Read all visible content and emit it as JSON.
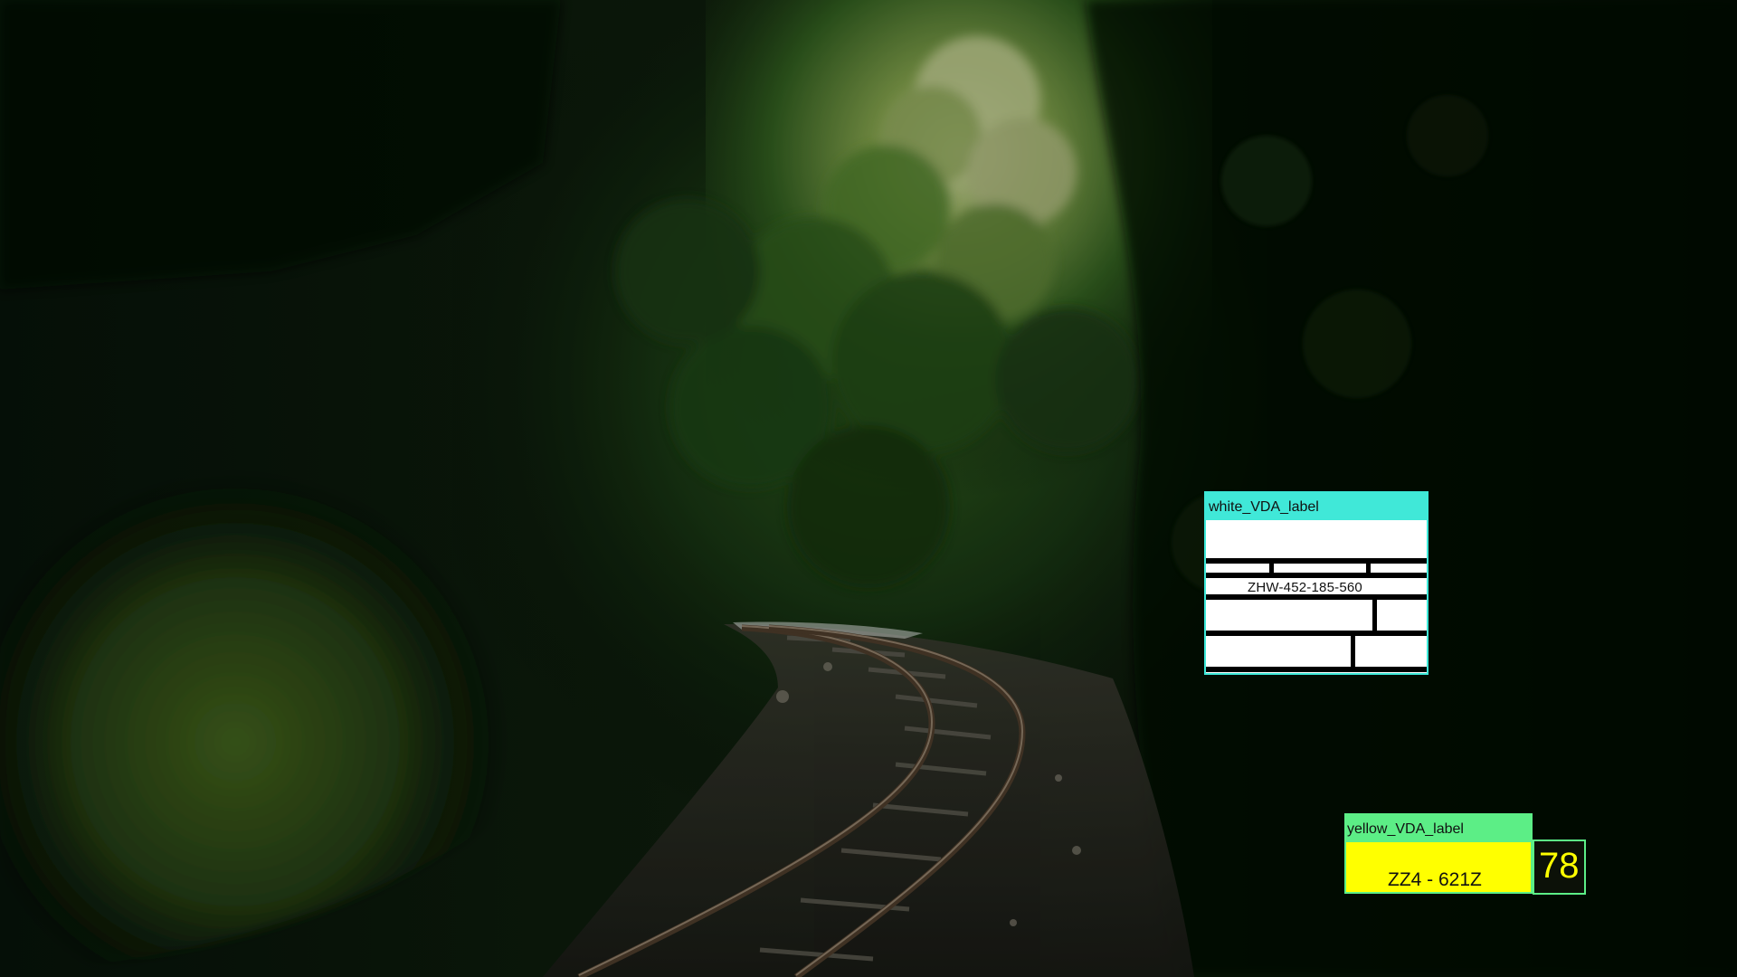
{
  "annotations": {
    "white_label": {
      "title": "white_VDA_label",
      "code": "ZHW-452-185-560",
      "border_color": "#3de8d8"
    },
    "yellow_label": {
      "title": "yellow_VDA_label",
      "code": "ZZ4 - 621Z",
      "score": "78",
      "border_color": "#5cee86",
      "fill_color": "#ffff00"
    }
  }
}
